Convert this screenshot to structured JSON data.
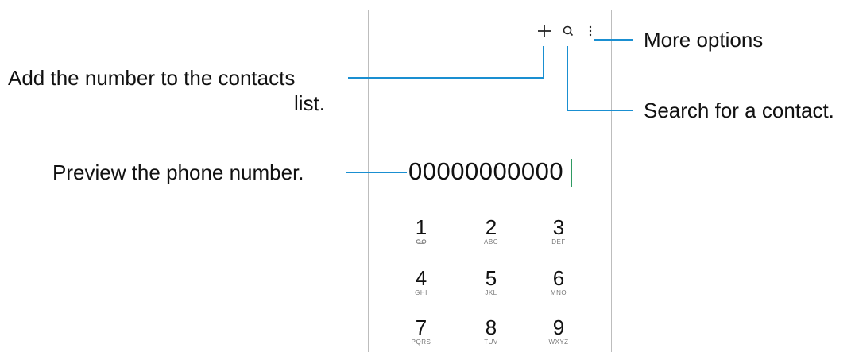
{
  "toolbar": {
    "icons": [
      "plus-icon",
      "search-icon",
      "more-options-icon"
    ]
  },
  "dialer": {
    "number": "00000000000",
    "keys": [
      {
        "digit": "1",
        "sub": "voicemail-icon"
      },
      {
        "digit": "2",
        "sub": "ABC"
      },
      {
        "digit": "3",
        "sub": "DEF"
      },
      {
        "digit": "4",
        "sub": "GHI"
      },
      {
        "digit": "5",
        "sub": "JKL"
      },
      {
        "digit": "6",
        "sub": "MNO"
      },
      {
        "digit": "7",
        "sub": "PQRS"
      },
      {
        "digit": "8",
        "sub": "TUV"
      },
      {
        "digit": "9",
        "sub": "WXYZ"
      }
    ]
  },
  "callouts": {
    "more_options": "More options",
    "add_contact_line1": "Add the number to the contacts",
    "add_contact_line2": "list.",
    "search": "Search for a contact.",
    "preview": "Preview the phone number."
  },
  "colors": {
    "callout_line": "#1a8fd1",
    "cursor": "#2f9a62",
    "frame_border": "#bdbdbd"
  }
}
